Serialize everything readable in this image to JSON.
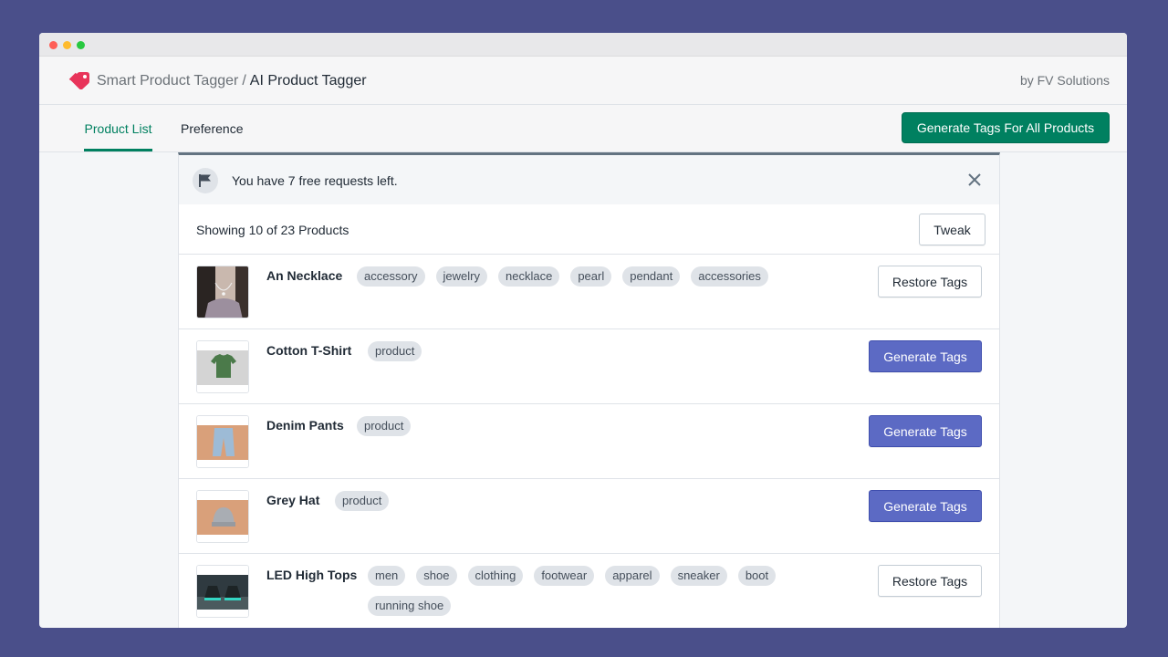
{
  "window": {
    "breadcrumb_parent": "Smart Product Tagger",
    "breadcrumb_separator": "/",
    "breadcrumb_current": "AI Product Tagger",
    "byline": "by FV Solutions"
  },
  "tabs": [
    {
      "label": "Product List",
      "active": true
    },
    {
      "label": "Preference",
      "active": false
    }
  ],
  "actions": {
    "generate_all_label": "Generate Tags For All Products"
  },
  "banner": {
    "text": "You have 7 free requests left.",
    "icon": "flag-icon"
  },
  "list": {
    "showing_text": "Showing 10 of 23 Products",
    "tweak_label": "Tweak",
    "products": [
      {
        "name": "An Necklace",
        "tags": [
          "accessory",
          "jewelry",
          "necklace",
          "pearl",
          "pendant",
          "accessories"
        ],
        "action": "Restore Tags"
      },
      {
        "name": "Cotton T-Shirt",
        "tags": [
          "product"
        ],
        "action": "Generate Tags"
      },
      {
        "name": "Denim Pants",
        "tags": [
          "product"
        ],
        "action": "Generate Tags"
      },
      {
        "name": "Grey Hat",
        "tags": [
          "product"
        ],
        "action": "Generate Tags"
      },
      {
        "name": "LED High Tops",
        "tags": [
          "men",
          "shoe",
          "clothing",
          "footwear",
          "apparel",
          "sneaker",
          "boot",
          "running shoe"
        ],
        "action": "Restore Tags"
      }
    ]
  },
  "colors": {
    "background": "#4a4f8a",
    "primary_green": "#008060",
    "indigo": "#5c6ac4",
    "tag_gray": "#dfe3e8",
    "logo_red": "#e8345a"
  }
}
